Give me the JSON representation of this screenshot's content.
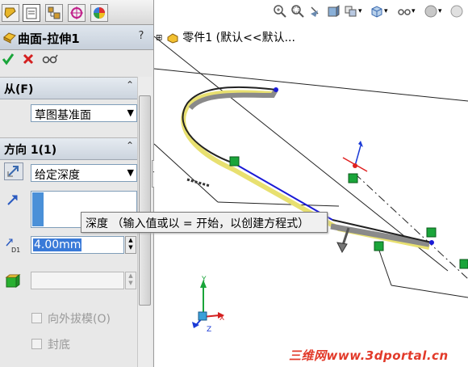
{
  "panel": {
    "feature_title": "曲面-拉伸1",
    "help": "?",
    "tabs": [
      "feature-manager",
      "property-manager",
      "configuration-manager",
      "dimxpert-manager",
      "display-manager"
    ],
    "actions": [
      "ok-check",
      "cancel-x",
      "preview-glasses"
    ],
    "from_section": {
      "title": "从(F)",
      "start_condition": "草图基准面"
    },
    "direction1_section": {
      "title": "方向 1(1)",
      "end_condition": "给定深度",
      "depth_value": "4.00mm",
      "depth_icon_label": "D1"
    },
    "options": {
      "draft_outward": "向外拔模(O)",
      "cap_end": "封底"
    }
  },
  "viewport": {
    "tree_item": "零件1  (默认<<默认...",
    "tooltip": "深度 （输入值或以 = 开始，以创建方程式）",
    "watermark": "三维网www.3dportal.cn",
    "triad": {
      "y": "Y",
      "x": "X",
      "z": "Z"
    },
    "colors": {
      "selected_edge": "#1a1ad6",
      "surface_preview": "#e8e070",
      "edge_dark": "#3a3a3a",
      "handle_green": "#1aa53a",
      "watermark": "#e23a2a"
    }
  }
}
